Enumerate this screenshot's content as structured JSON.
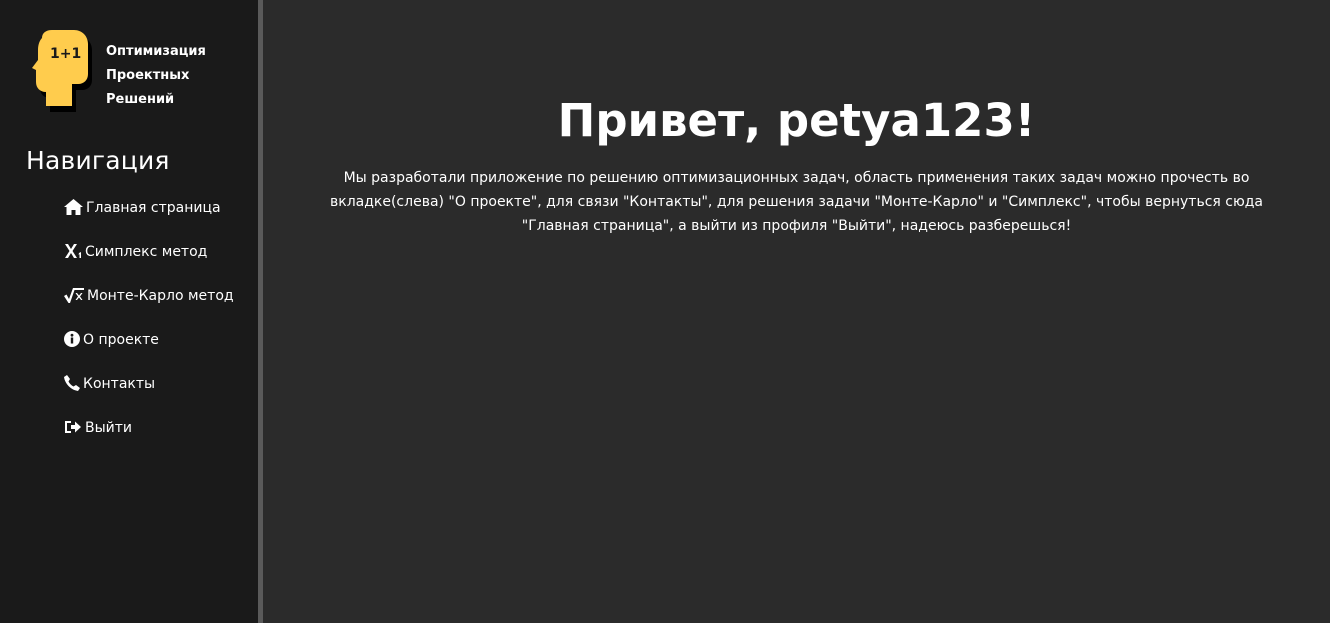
{
  "brand": {
    "logo_text": "1+1",
    "title_lines": [
      "Оптимизация",
      "Проектных",
      "Решений"
    ]
  },
  "sidebar": {
    "heading": "Навигация",
    "items": [
      {
        "label": "Главная страница",
        "icon": "home-icon"
      },
      {
        "label": "Симплекс метод",
        "icon": "subscript-x-icon"
      },
      {
        "label": "Монте-Карло метод",
        "icon": "square-root-icon"
      },
      {
        "label": "О проекте",
        "icon": "info-icon"
      },
      {
        "label": "Контакты",
        "icon": "phone-icon"
      },
      {
        "label": "Выйти",
        "icon": "sign-out-icon"
      }
    ]
  },
  "main": {
    "greeting": "Привет, petya123!",
    "intro": "Мы разработали приложение по решению оптимизационных задач, область применения таких задач можно прочесть во вкладке(слева) \"О проекте\", для связи \"Контакты\", для решения задачи \"Монте-Карло\" и \"Симплекс\", чтобы вернуться сюда \"Главная страница\", а выйти из профиля \"Выйти\", надеюсь разберешься!"
  },
  "colors": {
    "sidebar_bg": "#1a1a1a",
    "main_bg": "#2b2b2b",
    "divider": "#5a5a5a",
    "logo_yellow": "#ffcc4d",
    "text": "#ffffff"
  }
}
